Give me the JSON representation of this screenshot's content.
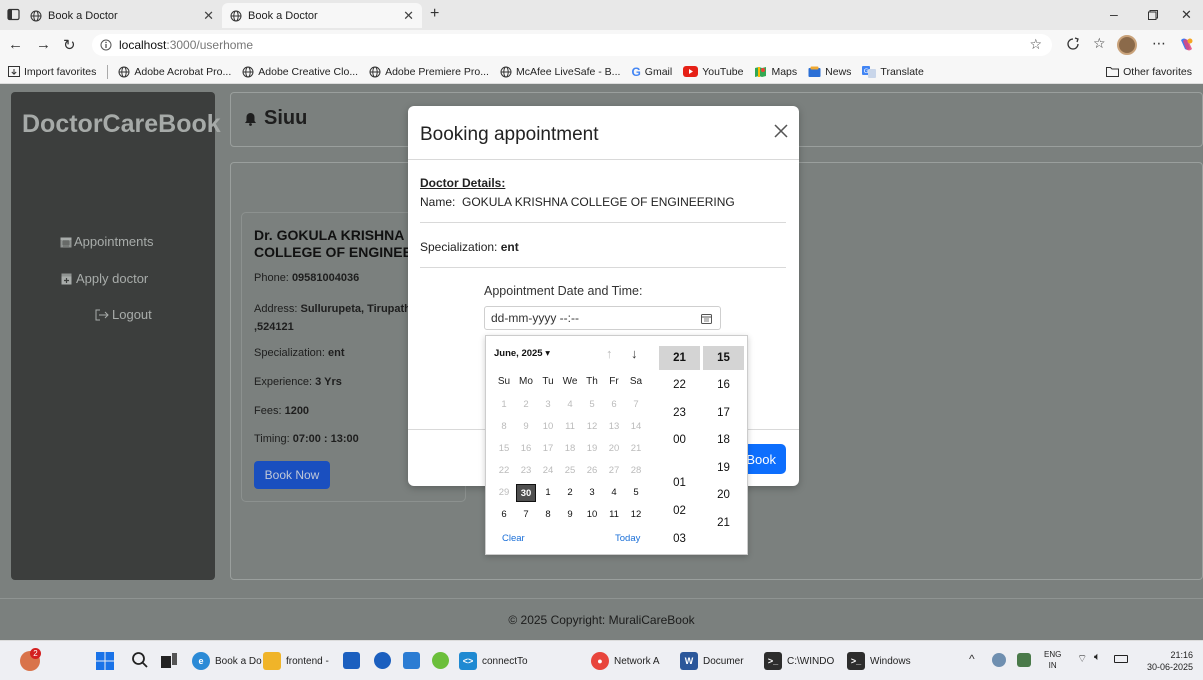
{
  "browser": {
    "tabs": [
      {
        "title": "Book a Doctor"
      },
      {
        "title": "Book a Doctor"
      }
    ],
    "url_host": "localhost",
    "url_path": ":3000/userhome",
    "favorites": [
      "Import favorites",
      "Adobe Acrobat Pro...",
      "Adobe Creative Clo...",
      "Adobe Premiere Pro...",
      "McAfee LiveSafe - B...",
      "Gmail",
      "YouTube",
      "Maps",
      "News",
      "Translate"
    ],
    "other_favorites": "Other favorites"
  },
  "app": {
    "brand": "DoctorCareBook",
    "header_title": "Siuu",
    "sidebar": {
      "appointments": "Appointments",
      "apply_doctor": "Apply doctor",
      "logout": "Logout"
    },
    "doctor_card": {
      "name_line1": "Dr. GOKULA KRISHNA",
      "name_line2": "COLLEGE OF ENGINEE",
      "phone_label": "Phone:",
      "phone": "09581004036",
      "address_label": "Address:",
      "address_line1": "Sullurupeta, Tirupath",
      "address_line2": ",524121",
      "specialization_label": "Specialization:",
      "specialization": "ent",
      "experience_label": "Experience:",
      "experience": "3 Yrs",
      "fees_label": "Fees:",
      "fees": "1200",
      "timing_label": "Timing:",
      "timing": "07:00 : 13:00",
      "book_button": "Book Now"
    },
    "footer": "© 2025 Copyright: MuraliCareBook"
  },
  "modal": {
    "title": "Booking appointment",
    "doctor_details_heading": "Doctor Details:",
    "name_label": "Name:",
    "name_value": "GOKULA KRISHNA COLLEGE OF ENGINEERING",
    "specialization_label": "Specialization:",
    "specialization_value": "ent",
    "appointment_label": "Appointment Date and Time:",
    "datetime_placeholder": "dd-mm-yyyy --:--",
    "book_button": "Book"
  },
  "datepicker": {
    "month_label": "June, 2025 ▾",
    "day_names": [
      "Su",
      "Mo",
      "Tu",
      "We",
      "Th",
      "Fr",
      "Sa"
    ],
    "weeks": [
      [
        "1",
        "2",
        "3",
        "4",
        "5",
        "6",
        "7"
      ],
      [
        "8",
        "9",
        "10",
        "11",
        "12",
        "13",
        "14"
      ],
      [
        "15",
        "16",
        "17",
        "18",
        "19",
        "20",
        "21"
      ],
      [
        "22",
        "23",
        "24",
        "25",
        "26",
        "27",
        "28"
      ],
      [
        "29",
        "30",
        "1",
        "2",
        "3",
        "4",
        "5"
      ],
      [
        "6",
        "7",
        "8",
        "9",
        "10",
        "11",
        "12"
      ]
    ],
    "selected_day": "30",
    "clear": "Clear",
    "today": "Today",
    "hours": [
      "21",
      "22",
      "23",
      "00",
      "01",
      "02",
      "03"
    ],
    "minutes": [
      "15",
      "16",
      "17",
      "18",
      "19",
      "20",
      "21"
    ],
    "selected_hour": "21",
    "selected_minute": "15"
  },
  "taskbar": {
    "notification_count": "2",
    "apps": [
      "Book a Do",
      "frontend -",
      "connectTo",
      "Network A",
      "Documer",
      "C:\\WINDO",
      "Windows"
    ],
    "lang_line1": "ENG",
    "lang_line2": "IN",
    "time": "21:16",
    "date": "30-06-2025"
  },
  "colors": {
    "page_bg": "#7b807e",
    "sidebar_bg": "#3c3e3d",
    "primary_button": "#0d6efd"
  }
}
